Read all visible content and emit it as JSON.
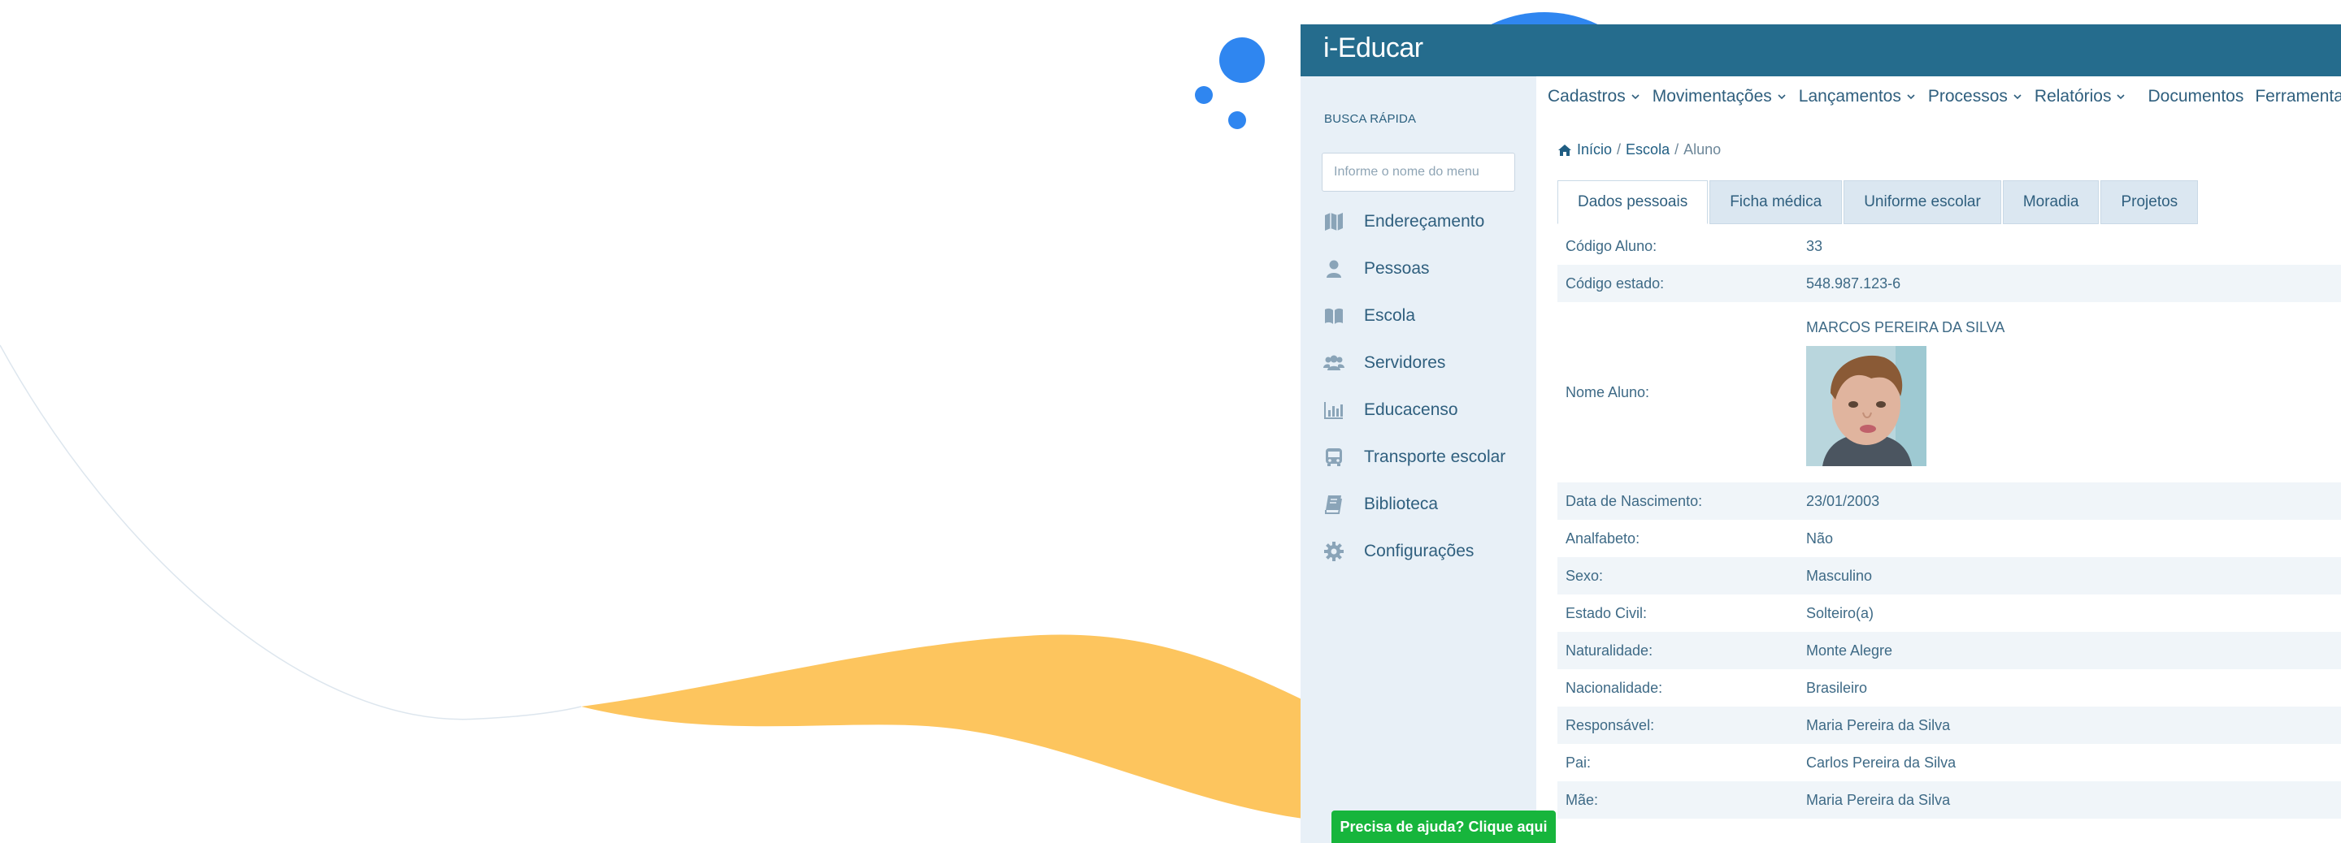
{
  "app": {
    "title": "i-Educar"
  },
  "sidebar": {
    "quick_search_label": "BUSCA RÁPIDA",
    "search_placeholder": "Informe o nome do menu",
    "items": [
      {
        "label": "Endereçamento",
        "icon": "map-icon"
      },
      {
        "label": "Pessoas",
        "icon": "user-icon"
      },
      {
        "label": "Escola",
        "icon": "book-open-icon"
      },
      {
        "label": "Servidores",
        "icon": "users-icon"
      },
      {
        "label": "Educacenso",
        "icon": "bar-chart-icon"
      },
      {
        "label": "Transporte escolar",
        "icon": "bus-icon"
      },
      {
        "label": "Biblioteca",
        "icon": "book-icon"
      },
      {
        "label": "Configurações",
        "icon": "gear-icon"
      }
    ]
  },
  "topnav": {
    "items": [
      {
        "label": "Cadastros",
        "dropdown": true
      },
      {
        "label": "Movimentações",
        "dropdown": true
      },
      {
        "label": "Lançamentos",
        "dropdown": true
      },
      {
        "label": "Processos",
        "dropdown": true
      },
      {
        "label": "Relatórios",
        "dropdown": true
      },
      {
        "label": "Documentos",
        "dropdown": false
      },
      {
        "label": "Ferramentas",
        "dropdown": true
      }
    ]
  },
  "breadcrumb": {
    "home": "Início",
    "school": "Escola",
    "current": "Aluno",
    "separator": "/"
  },
  "tabs": [
    {
      "label": "Dados pessoais",
      "active": true
    },
    {
      "label": "Ficha médica",
      "active": false
    },
    {
      "label": "Uniforme escolar",
      "active": false
    },
    {
      "label": "Moradia",
      "active": false
    },
    {
      "label": "Projetos",
      "active": false
    }
  ],
  "student": {
    "rows": [
      {
        "label": "Código Aluno:",
        "value": "33"
      },
      {
        "label": "Código estado:",
        "value": "548.987.123-6"
      },
      {
        "label": "Nome Aluno:",
        "value": "MARCOS PEREIRA DA SILVA"
      },
      {
        "label": "Data de Nascimento:",
        "value": "23/01/2003"
      },
      {
        "label": "Analfabeto:",
        "value": "Não"
      },
      {
        "label": "Sexo:",
        "value": "Masculino"
      },
      {
        "label": "Estado Civil:",
        "value": "Solteiro(a)"
      },
      {
        "label": "Naturalidade:",
        "value": "Monte Alegre"
      },
      {
        "label": "Nacionalidade:",
        "value": "Brasileiro"
      },
      {
        "label": "Responsável:",
        "value": "Maria Pereira da Silva"
      },
      {
        "label": "Pai:",
        "value": "Carlos Pereira da Silva"
      },
      {
        "label": "Mãe:",
        "value": "Maria Pereira da Silva"
      }
    ]
  },
  "help": {
    "label": "Precisa de ajuda? Clique aqui"
  },
  "colors": {
    "header": "#256c8d",
    "sidebar_bg": "#e8f0f7",
    "accent_blue": "#2f86f0",
    "wave_yellow": "#fdc55e",
    "help_green": "#17b53c",
    "text": "#2f5f7e"
  }
}
